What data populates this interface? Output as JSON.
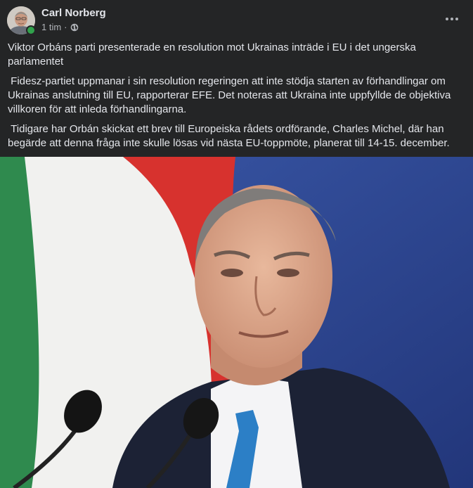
{
  "post": {
    "author": "Carl Norberg",
    "time": "1 tim",
    "separator": "·",
    "privacy_icon": "globe-icon",
    "more_icon": "more-horizontal-icon",
    "paragraphs": [
      "Viktor Orbáns parti presenterade en resolution mot Ukrainas inträde i EU i det ungerska parlamentet",
      " Fidesz-partiet uppmanar i sin resolution regeringen att inte stödja starten av förhandlingar om Ukrainas anslutning till EU, rapporterar EFE. Det noteras att Ukraina inte uppfyllde de objektiva villkoren för att inleda förhandlingarna.",
      " Tidigare har Orbán skickat ett brev till Europeiska rådets ordförande, Charles Michel, där han begärde att denna fråga inte skulle lösas vid nästa EU-toppmöte, planerat till 14-15. december."
    ]
  },
  "colors": {
    "background": "#242526",
    "text": "#e4e6eb",
    "secondary_text": "#b0b3b8",
    "online": "#31a24c"
  }
}
